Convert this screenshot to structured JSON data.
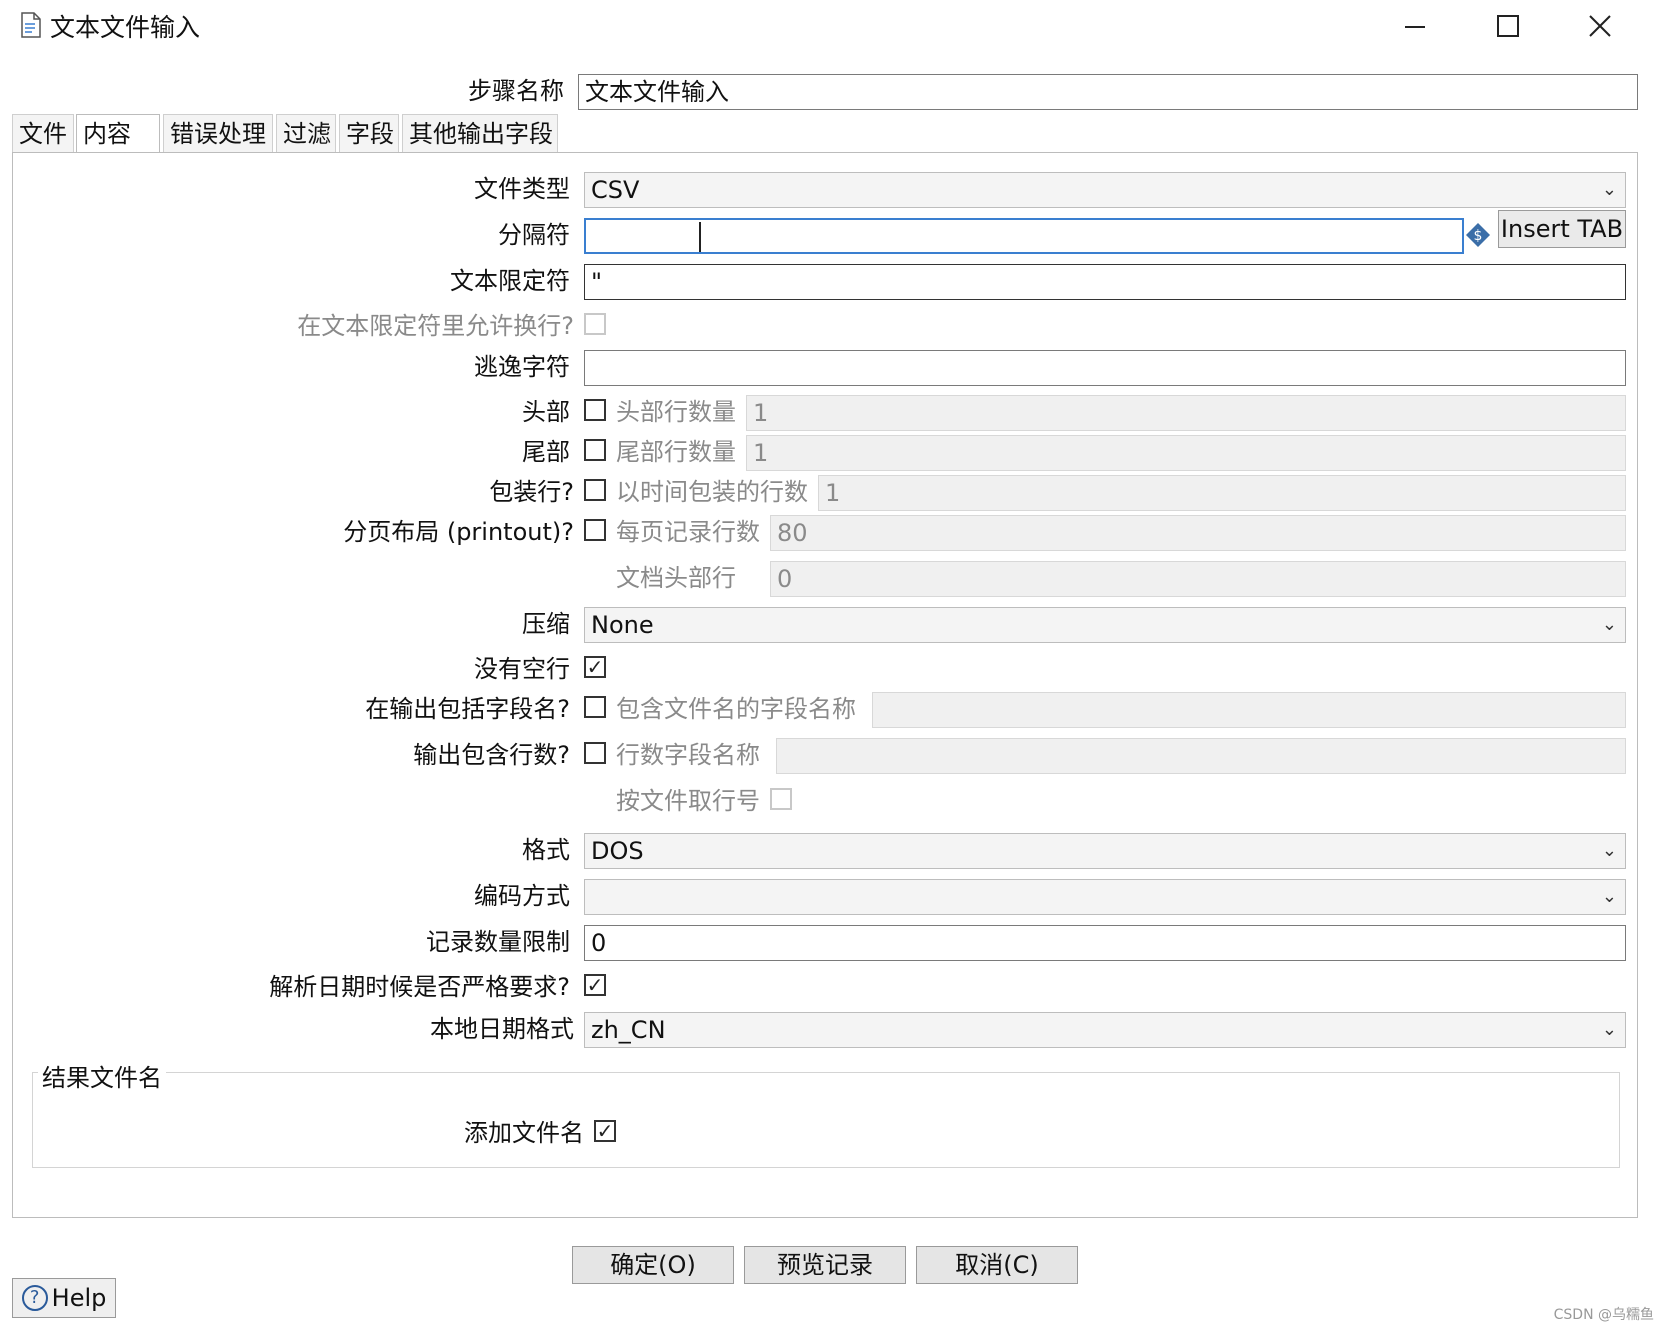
{
  "window": {
    "title": "文本文件输入",
    "minimize": "—",
    "maximize": "☐",
    "close": "✕"
  },
  "step_name": {
    "label": "步骤名称",
    "value": "文本文件输入"
  },
  "tabs": [
    {
      "label": "文件"
    },
    {
      "label": "内容"
    },
    {
      "label": "错误处理"
    },
    {
      "label": "过滤"
    },
    {
      "label": "字段"
    },
    {
      "label": "其他输出字段"
    }
  ],
  "content": {
    "file_type": {
      "label": "文件类型",
      "value": "CSV"
    },
    "separator": {
      "label": "分隔符",
      "value": "",
      "insert_tab": "Insert TAB"
    },
    "enclosure": {
      "label": "文本限定符",
      "value": "\""
    },
    "allow_breaks": {
      "label": "在文本限定符里允许换行?"
    },
    "escape": {
      "label": "逃逸字符",
      "value": ""
    },
    "header": {
      "label": "头部",
      "sublabel": "头部行数量",
      "value": "1"
    },
    "footer": {
      "label": "尾部",
      "sublabel": "尾部行数量",
      "value": "1"
    },
    "wrap": {
      "label": "包装行?",
      "sublabel": "以时间包装的行数",
      "value": "1"
    },
    "paged": {
      "label": "分页布局 (printout)?",
      "sublabel": "每页记录行数",
      "value": "80"
    },
    "doc_header": {
      "label": "文档头部行",
      "value": "0"
    },
    "compression": {
      "label": "压缩",
      "value": "None"
    },
    "no_empty": {
      "label": "没有空行",
      "checked": true
    },
    "include_filename": {
      "label": "在输出包括字段名?",
      "sublabel": "包含文件名的字段名称",
      "value": ""
    },
    "include_rownum": {
      "label": "输出包含行数?",
      "sublabel": "行数字段名称",
      "value": ""
    },
    "rownum_by_file": {
      "label": "按文件取行号"
    },
    "format": {
      "label": "格式",
      "value": "DOS"
    },
    "encoding": {
      "label": "编码方式",
      "value": ""
    },
    "limit": {
      "label": "记录数量限制",
      "value": "0"
    },
    "strict_date": {
      "label": "解析日期时候是否严格要求?",
      "checked": true
    },
    "locale": {
      "label": "本地日期格式",
      "value": "zh_CN"
    }
  },
  "result_group": {
    "title": "结果文件名",
    "add_filename_label": "添加文件名",
    "checked": true
  },
  "buttons": {
    "ok": "确定(O)",
    "preview": "预览记录",
    "cancel": "取消(C)",
    "help": "Help"
  },
  "watermark": "CSDN @乌糯鱼",
  "check_mark": "✓"
}
